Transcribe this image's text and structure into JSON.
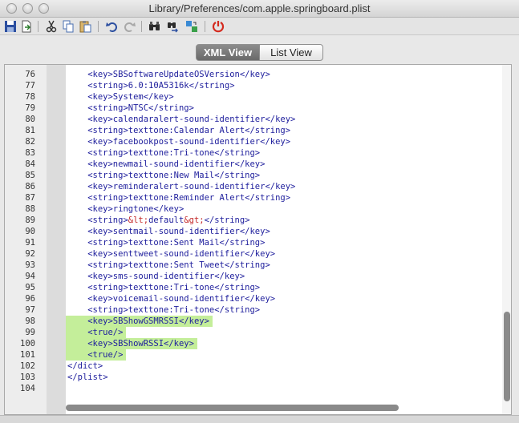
{
  "window": {
    "title": "Library/Preferences/com.apple.springboard.plist"
  },
  "toolbar": {
    "icons": [
      "save-icon",
      "export-icon",
      "cut-icon",
      "copy-icon",
      "paste-icon",
      "undo-icon",
      "redo-icon",
      "find-icon",
      "find-next-icon",
      "replace-icon",
      "stop-icon"
    ]
  },
  "tabs": {
    "xml_view": "XML View",
    "list_view": "List View",
    "selected": "XML View"
  },
  "colors": {
    "highlight": "#c4ee9a",
    "tag": "#1d1d9c",
    "entity": "#c42a2a"
  },
  "editor": {
    "lines": [
      {
        "num": "76",
        "indent": "    ",
        "text": "<key>SBSoftwareUpdateOSVersion</key>",
        "highlight": false
      },
      {
        "num": "77",
        "indent": "    ",
        "text": "<string>6.0:10A5316k</string>",
        "highlight": false
      },
      {
        "num": "78",
        "indent": "    ",
        "text": "<key>System</key>",
        "highlight": false
      },
      {
        "num": "79",
        "indent": "    ",
        "text": "<string>NTSC</string>",
        "highlight": false
      },
      {
        "num": "80",
        "indent": "    ",
        "text": "<key>calendaralert-sound-identifier</key>",
        "highlight": false
      },
      {
        "num": "81",
        "indent": "    ",
        "text": "<string>texttone:Calendar Alert</string>",
        "highlight": false
      },
      {
        "num": "82",
        "indent": "    ",
        "text": "<key>facebookpost-sound-identifier</key>",
        "highlight": false
      },
      {
        "num": "83",
        "indent": "    ",
        "text": "<string>texttone:Tri-tone</string>",
        "highlight": false
      },
      {
        "num": "84",
        "indent": "    ",
        "text": "<key>newmail-sound-identifier</key>",
        "highlight": false
      },
      {
        "num": "85",
        "indent": "    ",
        "text": "<string>texttone:New Mail</string>",
        "highlight": false
      },
      {
        "num": "86",
        "indent": "    ",
        "text": "<key>reminderalert-sound-identifier</key>",
        "highlight": false
      },
      {
        "num": "87",
        "indent": "    ",
        "text": "<string>texttone:Reminder Alert</string>",
        "highlight": false
      },
      {
        "num": "88",
        "indent": "    ",
        "text": "<key>ringtone</key>",
        "highlight": false
      },
      {
        "num": "89",
        "indent": "    ",
        "pre": "<string>",
        "ent1": "&lt;",
        "mid": "default",
        "ent2": "&gt;",
        "post": "</string>",
        "highlight": false
      },
      {
        "num": "90",
        "indent": "    ",
        "text": "<key>sentmail-sound-identifier</key>",
        "highlight": false
      },
      {
        "num": "91",
        "indent": "    ",
        "text": "<string>texttone:Sent Mail</string>",
        "highlight": false
      },
      {
        "num": "92",
        "indent": "    ",
        "text": "<key>senttweet-sound-identifier</key>",
        "highlight": false
      },
      {
        "num": "93",
        "indent": "    ",
        "text": "<string>texttone:Sent Tweet</string>",
        "highlight": false
      },
      {
        "num": "94",
        "indent": "    ",
        "text": "<key>sms-sound-identifier</key>",
        "highlight": false
      },
      {
        "num": "95",
        "indent": "    ",
        "text": "<string>texttone:Tri-tone</string>",
        "highlight": false
      },
      {
        "num": "96",
        "indent": "    ",
        "text": "<key>voicemail-sound-identifier</key>",
        "highlight": false
      },
      {
        "num": "97",
        "indent": "    ",
        "text": "<string>texttone:Tri-tone</string>",
        "highlight": false
      },
      {
        "num": "98",
        "indent": "    ",
        "text": "<key>SBShowGSMRSSI</key>",
        "highlight": true
      },
      {
        "num": "99",
        "indent": "    ",
        "text": "<true/>",
        "highlight": true
      },
      {
        "num": "100",
        "indent": "    ",
        "text": "<key>SBShowRSSI</key>",
        "highlight": true
      },
      {
        "num": "101",
        "indent": "    ",
        "text": "<true/>",
        "highlight": true
      },
      {
        "num": "102",
        "indent": "",
        "text": "</dict>",
        "highlight": false
      },
      {
        "num": "103",
        "indent": "",
        "text": "</plist>",
        "highlight": false
      },
      {
        "num": "104",
        "indent": "",
        "text": "",
        "highlight": false
      }
    ]
  }
}
